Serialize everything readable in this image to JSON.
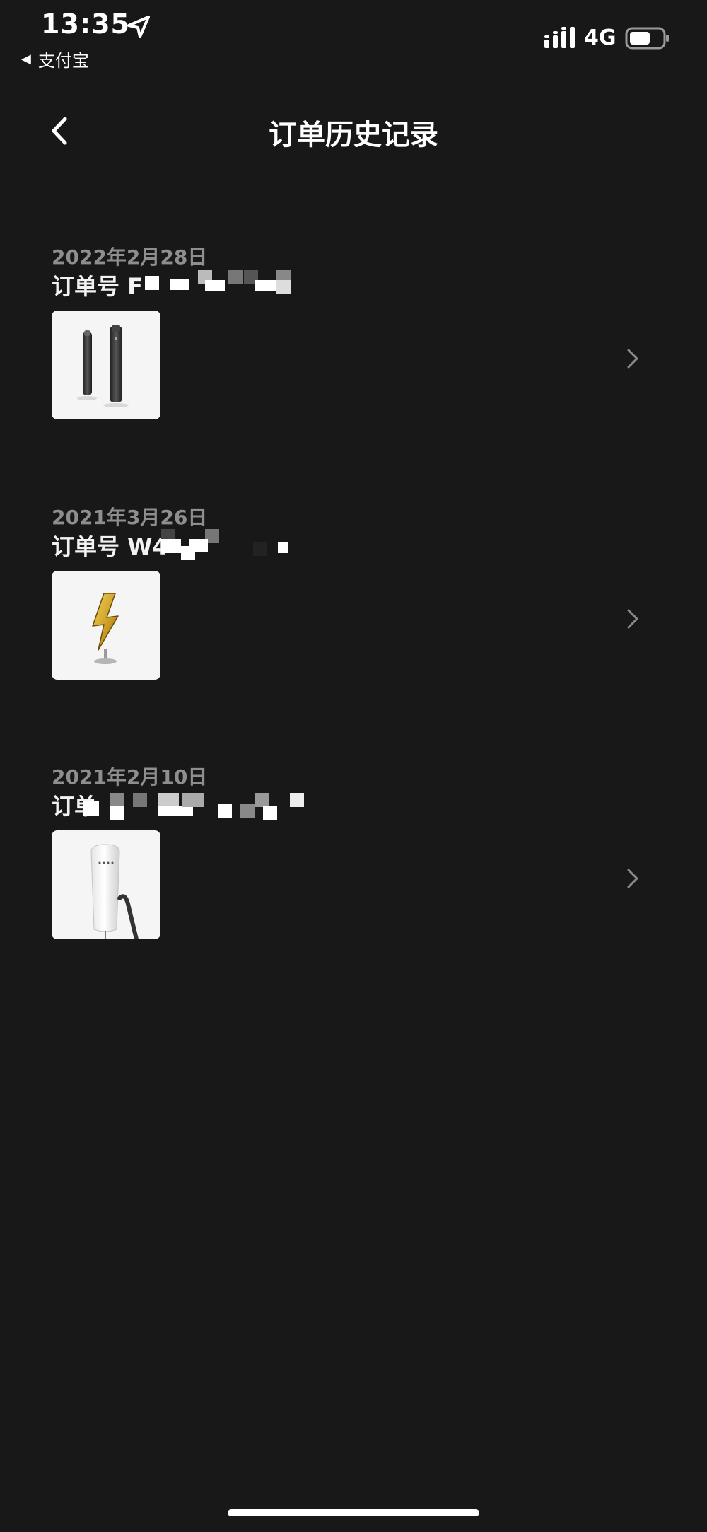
{
  "status_bar": {
    "time": "13:35",
    "back_app_label": "支付宝",
    "network": "4G",
    "icons": [
      "location-arrow-icon",
      "signal-bars-icon",
      "battery-icon"
    ]
  },
  "nav": {
    "title": "订单历史记录",
    "back_icon": "chevron-left-icon"
  },
  "orders": [
    {
      "date": "2022年2月28日",
      "number_prefix": "订单号 F",
      "product_image": "charging-cables-product",
      "chevron_icon": "chevron-right-icon"
    },
    {
      "date": "2021年3月26日",
      "number_prefix": "订单号 W4",
      "product_image": "lightning-bolt-product",
      "chevron_icon": "chevron-right-icon"
    },
    {
      "date": "2021年2月10日",
      "number_prefix": "订单",
      "product_image": "wall-connector-product",
      "chevron_icon": "chevron-right-icon"
    }
  ],
  "colors": {
    "background": "#181818",
    "text_primary": "#ffffff",
    "text_secondary": "#8e8e8e",
    "thumbnail_bg": "#f5f5f5"
  }
}
